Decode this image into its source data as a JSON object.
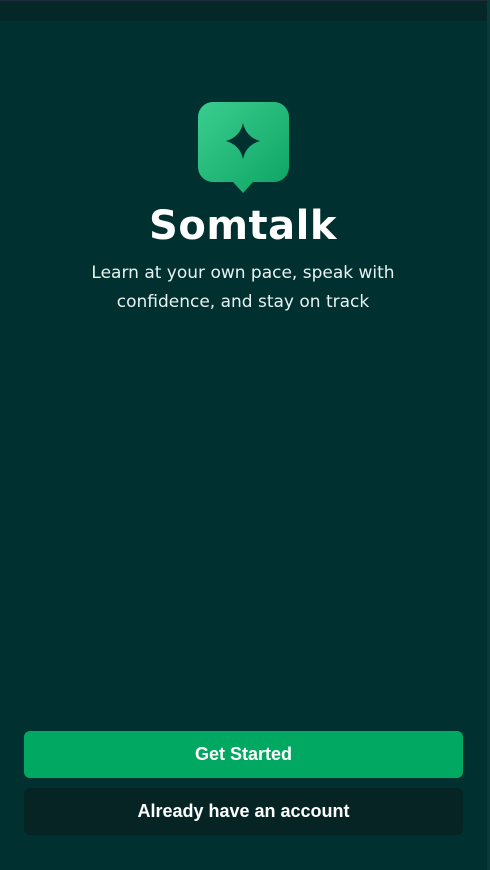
{
  "app": {
    "title": "Somtalk",
    "tagline": "Learn at your own pace, speak with confidence, and stay on track",
    "logo_icon": "sparkle-chat-bubble-icon"
  },
  "actions": {
    "primary_label": "Get Started",
    "secondary_label": "Already have an account"
  },
  "colors": {
    "background": "#00302f",
    "primary_button": "#00a862",
    "secondary_button": "#072424",
    "logo_gradient_start": "#35c98b",
    "logo_gradient_end": "#0fa664",
    "sparkle": "#00302f"
  }
}
